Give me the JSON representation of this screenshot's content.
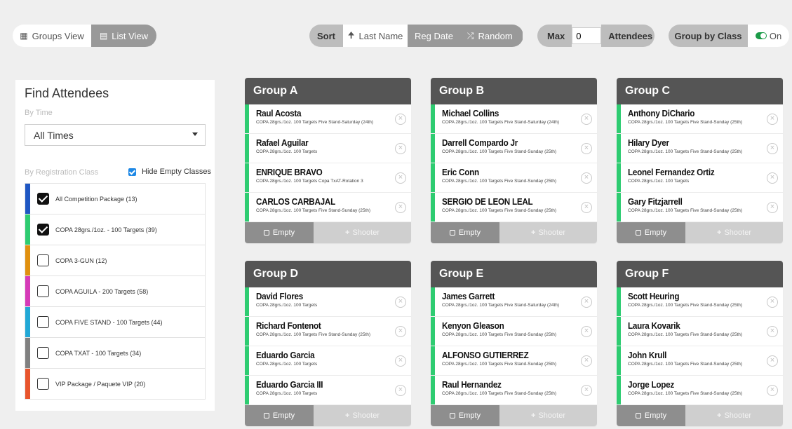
{
  "view_toggle": {
    "groups_label": "Groups View",
    "list_label": "List View"
  },
  "sort": {
    "label": "Sort",
    "last_name": "Last Name",
    "reg_date": "Reg Date",
    "random": "Random"
  },
  "max": {
    "label": "Max",
    "value": "0",
    "attendees_label": "Attendees"
  },
  "group_by_class": {
    "label": "Group by Class",
    "state": "On"
  },
  "find": {
    "title": "Find Attendees",
    "by_time_label": "By Time",
    "time_value": "All Times",
    "by_class_label": "By Registration Class",
    "hide_empty_label": "Hide Empty Classes",
    "classes": [
      {
        "label": "All Competition Package (13)",
        "color": "#1f57c3",
        "checked": true
      },
      {
        "label": "COPA 28grs./1oz. - 100 Targets (39)",
        "color": "#2ecc71",
        "checked": true
      },
      {
        "label": "COPA 3-GUN (12)",
        "color": "#e0900f",
        "checked": false
      },
      {
        "label": "COPA AGUILA - 200 Targets (58)",
        "color": "#d63bb8",
        "checked": false
      },
      {
        "label": "COPA FIVE STAND - 100 Targets (44)",
        "color": "#22a8d6",
        "checked": false
      },
      {
        "label": "COPA TXAT - 100 Targets (34)",
        "color": "#808080",
        "checked": false
      },
      {
        "label": "VIP Package / Paquete VIP (20)",
        "color": "#e8542c",
        "checked": false
      }
    ]
  },
  "footer": {
    "empty_label": "Empty",
    "shooter_label": "Shooter"
  },
  "groups": [
    {
      "title": "Group A",
      "members": [
        {
          "name": "Raul Acosta",
          "sub": "COPA 28grs./1oz. 100 Targets Five Stand-Saturday (24th)"
        },
        {
          "name": "Rafael Aguilar",
          "sub": "COPA 28grs./1oz. 100 Targets"
        },
        {
          "name": "ENRIQUE BRAVO",
          "sub": "COPA 28grs./1oz. 100 Targets Copa TxAT-Rotation 3"
        },
        {
          "name": "CARLOS CARBAJAL",
          "sub": "COPA 28grs./1oz. 100 Targets Five Stand-Sunday (25th)"
        }
      ]
    },
    {
      "title": "Group B",
      "members": [
        {
          "name": "Michael Collins",
          "sub": "COPA 28grs./1oz. 100 Targets Five Stand-Saturday (24th)"
        },
        {
          "name": "Darrell Compardo Jr",
          "sub": "COPA 28grs./1oz. 100 Targets Five Stand-Sunday (25th)"
        },
        {
          "name": "Eric Conn",
          "sub": "COPA 28grs./1oz. 100 Targets Five Stand-Sunday (25th)"
        },
        {
          "name": "SERGIO DE LEON LEAL",
          "sub": "COPA 28grs./1oz. 100 Targets Five Stand-Sunday (25th)"
        }
      ]
    },
    {
      "title": "Group C",
      "members": [
        {
          "name": "Anthony DiChario",
          "sub": "COPA 28grs./1oz. 100 Targets Five Stand-Sunday (25th)"
        },
        {
          "name": "Hilary Dyer",
          "sub": "COPA 28grs./1oz. 100 Targets Five Stand-Sunday (25th)"
        },
        {
          "name": "Leonel Fernandez Ortiz",
          "sub": "COPA 28grs./1oz. 100 Targets"
        },
        {
          "name": "Gary Fitzjarrell",
          "sub": "COPA 28grs./1oz. 100 Targets Five Stand-Sunday (25th)"
        }
      ]
    },
    {
      "title": "Group D",
      "members": [
        {
          "name": "David Flores",
          "sub": "COPA 28grs./1oz. 100 Targets"
        },
        {
          "name": "Richard Fontenot",
          "sub": "COPA 28grs./1oz. 100 Targets Five Stand-Sunday (25th)"
        },
        {
          "name": "Eduardo Garcia",
          "sub": "COPA 28grs./1oz. 100 Targets"
        },
        {
          "name": "Eduardo Garcia III",
          "sub": "COPA 28grs./1oz. 100 Targets"
        }
      ]
    },
    {
      "title": "Group E",
      "members": [
        {
          "name": "James Garrett",
          "sub": "COPA 28grs./1oz. 100 Targets Five Stand-Saturday (24th)"
        },
        {
          "name": "Kenyon Gleason",
          "sub": "COPA 28grs./1oz. 100 Targets Five Stand-Sunday (25th)"
        },
        {
          "name": "ALFONSO GUTIERREZ",
          "sub": "COPA 28grs./1oz. 100 Targets Five Stand-Sunday (25th)"
        },
        {
          "name": "Raul Hernandez",
          "sub": "COPA 28grs./1oz. 100 Targets Five Stand-Sunday (25th)"
        }
      ]
    },
    {
      "title": "Group F",
      "members": [
        {
          "name": "Scott Heuring",
          "sub": "COPA 28grs./1oz. 100 Targets Five Stand-Sunday (25th)"
        },
        {
          "name": "Laura Kovarik",
          "sub": "COPA 28grs./1oz. 100 Targets Five Stand-Sunday (25th)"
        },
        {
          "name": "John Krull",
          "sub": "COPA 28grs./1oz. 100 Targets Five Stand-Sunday (25th)"
        },
        {
          "name": "Jorge Lopez",
          "sub": "COPA 28grs./1oz. 100 Targets Five Stand-Sunday (25th)"
        }
      ]
    }
  ]
}
